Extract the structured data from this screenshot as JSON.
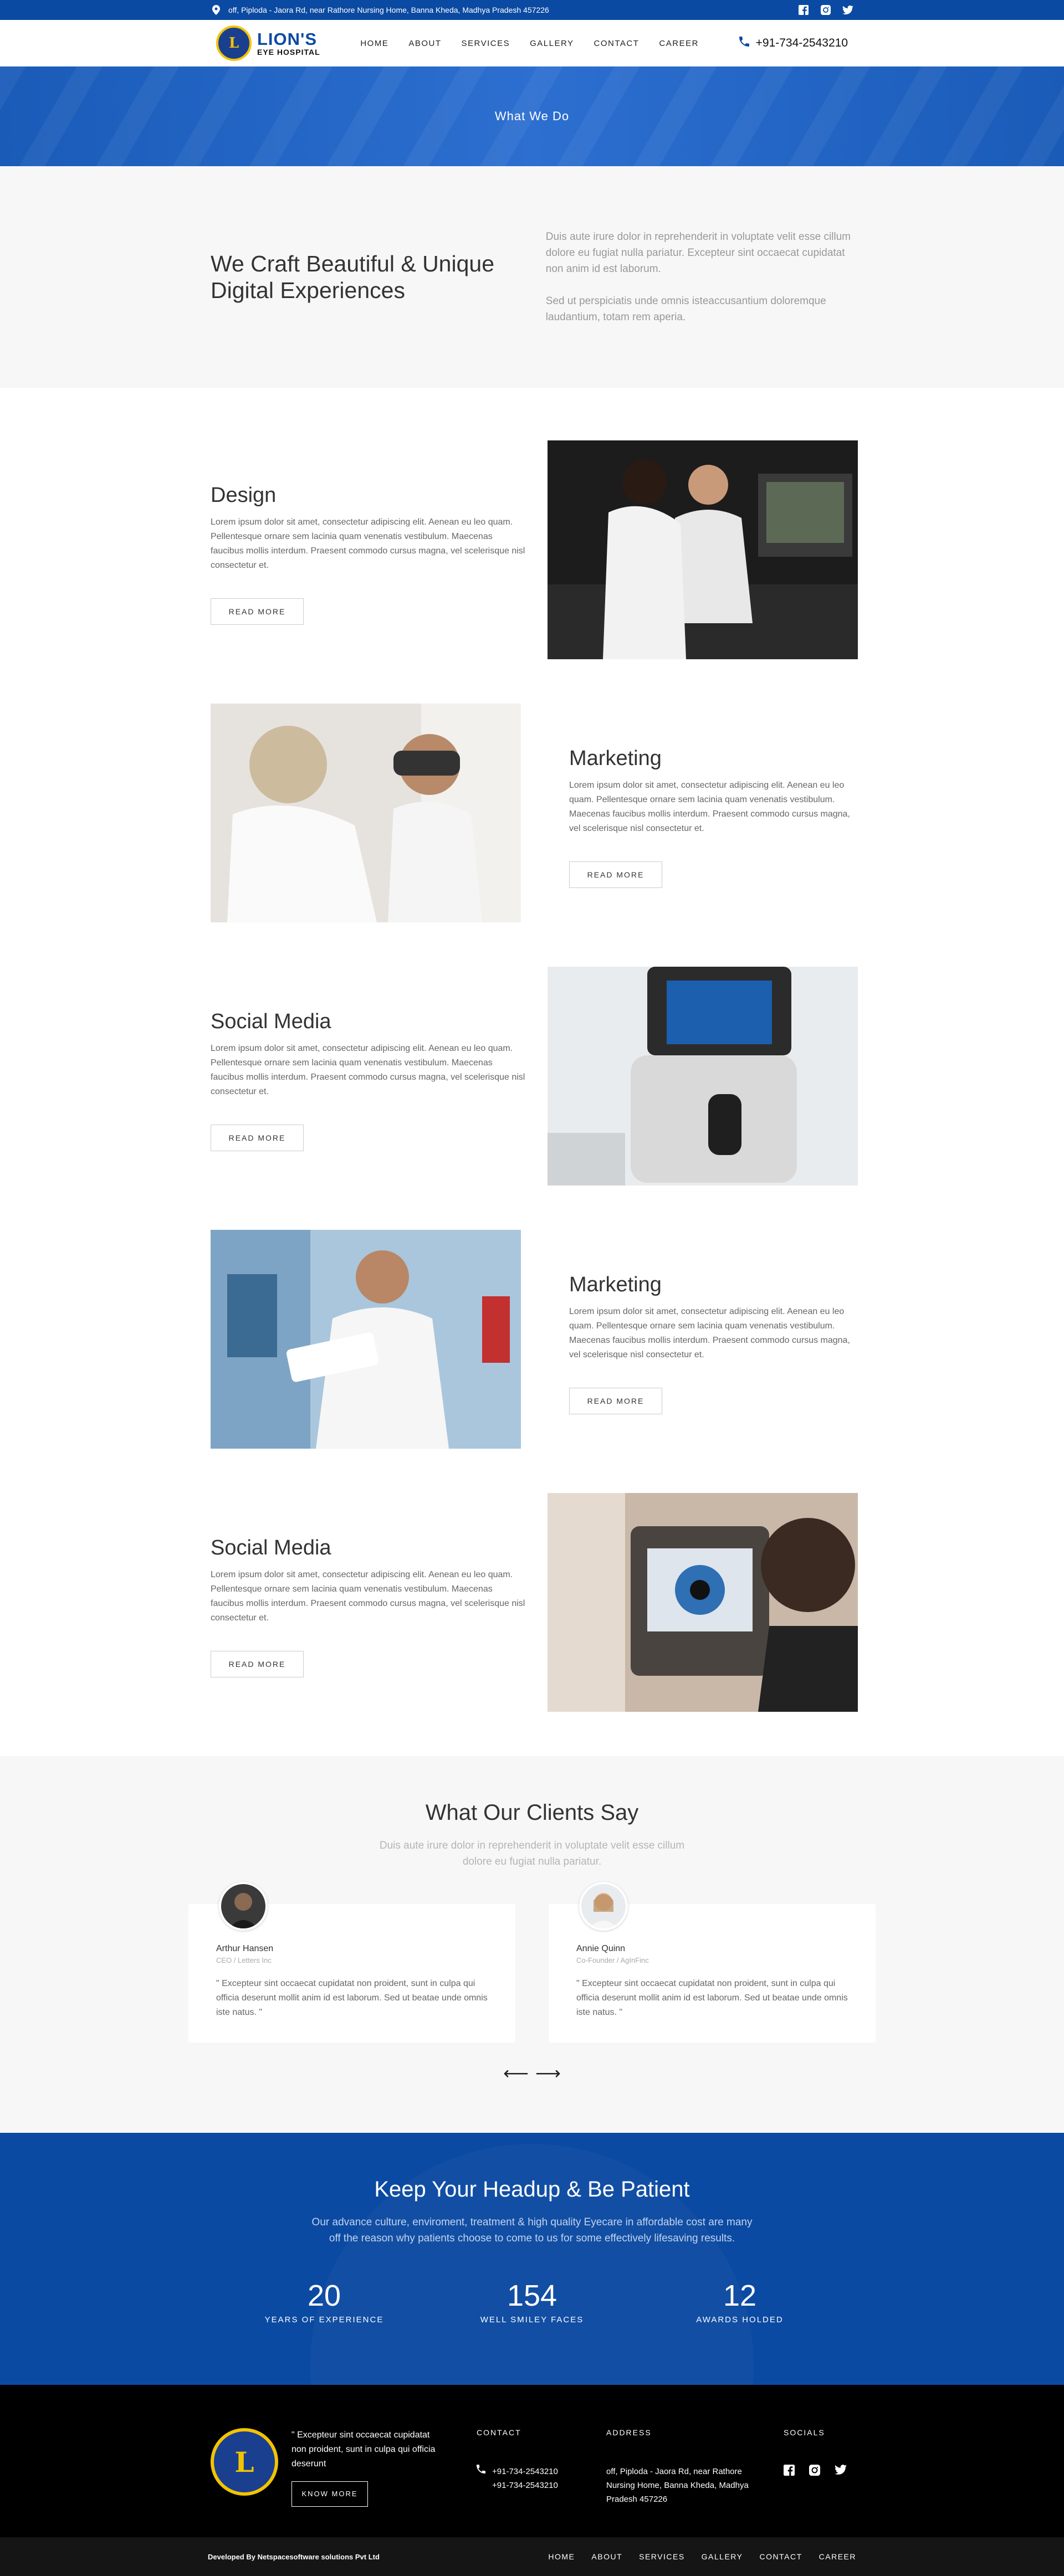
{
  "topbar": {
    "address": "off, Piploda - Jaora Rd, near Rathore Nursing Home, Banna Kheda, Madhya Pradesh 457226",
    "social_icons": [
      "facebook-icon",
      "instagram-icon",
      "twitter-icon"
    ]
  },
  "nav": {
    "brand_line1": "LION'S",
    "brand_line2": "EYE HOSPITAL",
    "logo_letter": "L",
    "menu": [
      "HOME",
      "ABOUT",
      "SERVICES",
      "GALLERY",
      "CONTACT",
      "CAREER"
    ],
    "phone": "+91-734-2543210"
  },
  "hero": {
    "title": "What We Do"
  },
  "intro": {
    "heading": "We Craft Beautiful & Unique Digital Experiences",
    "para1": "Duis aute irure dolor in reprehenderit in voluptate velit esse cillum dolore eu fugiat nulla pariatur. Excepteur sint occaecat cupidatat non anim id est laborum.",
    "para2": "Sed ut perspiciatis unde omnis isteaccusantium doloremque laudantium, totam rem aperia."
  },
  "features": [
    {
      "title": "Design",
      "text": "Lorem ipsum dolor sit amet, consectetur adipiscing elit. Aenean eu leo quam. Pellentesque ornare sem lacinia quam venenatis vestibulum. Maecenas faucibus mollis interdum. Praesent commodo cursus magna, vel scelerisque nisl consectetur et.",
      "button": "READ MORE"
    },
    {
      "title": "Marketing",
      "text": "Lorem ipsum dolor sit amet, consectetur adipiscing elit. Aenean eu leo quam. Pellentesque ornare sem lacinia quam venenatis vestibulum. Maecenas faucibus mollis interdum. Praesent commodo cursus magna, vel scelerisque nisl consectetur et.",
      "button": "READ MORE"
    },
    {
      "title": "Social Media",
      "text": "Lorem ipsum dolor sit amet, consectetur adipiscing elit. Aenean eu leo quam. Pellentesque ornare sem lacinia quam venenatis vestibulum. Maecenas faucibus mollis interdum. Praesent commodo cursus magna, vel scelerisque nisl consectetur et.",
      "button": "READ MORE"
    },
    {
      "title": "Marketing",
      "text": "Lorem ipsum dolor sit amet, consectetur adipiscing elit. Aenean eu leo quam. Pellentesque ornare sem lacinia quam venenatis vestibulum. Maecenas faucibus mollis interdum. Praesent commodo cursus magna, vel scelerisque nisl consectetur et.",
      "button": "READ MORE"
    },
    {
      "title": "Social Media",
      "text": "Lorem ipsum dolor sit amet, consectetur adipiscing elit. Aenean eu leo quam. Pellentesque ornare sem lacinia quam venenatis vestibulum. Maecenas faucibus mollis interdum. Praesent commodo cursus magna, vel scelerisque nisl consectetur et.",
      "button": "READ MORE"
    }
  ],
  "testimonials": {
    "heading": "What Our Clients Say",
    "sub": "Duis aute irure dolor in reprehenderit in voluptate velit esse cillum dolore eu fugiat nulla pariatur.",
    "items": [
      {
        "name": "Arthur Hansen",
        "role": "CEO / Letters Inc",
        "quote": "\" Excepteur sint occaecat cupidatat non proident, sunt in culpa qui officia deserunt mollit anim id est laborum. Sed ut beatae unde omnis iste natus. \""
      },
      {
        "name": "Annie Quinn",
        "role": "Co-Founder / AgInFinc",
        "quote": "\" Excepteur sint occaecat cupidatat non proident, sunt in culpa qui officia deserunt mollit anim id est laborum. Sed ut beatae unde omnis iste natus. \""
      }
    ],
    "prev": "⟵",
    "next": "⟶"
  },
  "counters": {
    "heading": "Keep Your Headup & Be Patient",
    "sub": "Our advance culture, enviroment, treatment & high quality Eyecare in affordable cost are many off the reason why patients choose to come to us for some effectively lifesaving results.",
    "stats": [
      {
        "num": "20",
        "label": "YEARS OF EXPERIENCE"
      },
      {
        "num": "154",
        "label": "WELL SMILEY FACES"
      },
      {
        "num": "12",
        "label": "AWARDS HOLDED"
      }
    ]
  },
  "footer": {
    "logo_letter": "L",
    "quote": "\" Excepteur sint occaecat cupidatat non proident, sunt in culpa qui officia deserunt",
    "button": "KNOW MORE",
    "contact_title": "CONTACT",
    "phone1": "+91-734-2543210",
    "phone2": "+91-734-2543210",
    "address_title": "ADDRESS",
    "address": "off, Piploda - Jaora Rd, near Rathore Nursing Home, Banna Kheda, Madhya Pradesh 457226",
    "socials_title": "SOCIALS",
    "developer": "Developed By Netspacesoftware solutions Pvt Ltd",
    "links": [
      "HOME",
      "ABOUT",
      "SERVICES",
      "GALLERY",
      "CONTACT",
      "CAREER"
    ]
  },
  "colors": {
    "brand_blue": "#0b4aa2",
    "logo_gold": "#f2c400"
  }
}
